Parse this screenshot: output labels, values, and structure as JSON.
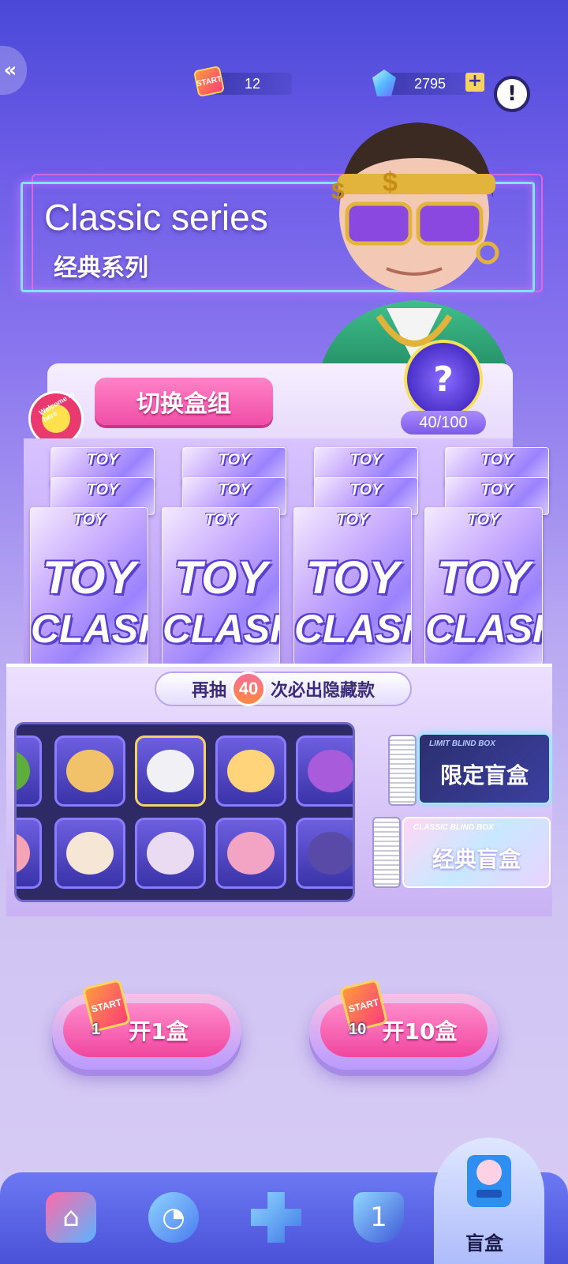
{
  "topbar": {
    "tickets": "12",
    "ticket_icon_label": "START",
    "gems": "2795",
    "plus": "+",
    "info": "!"
  },
  "series": {
    "title_en": "Classic series",
    "title_zh": "经典系列"
  },
  "shelf": {
    "switch_label": "切换盒组",
    "welcome_badge": "Welcome to here",
    "mystery_count": "40/100",
    "mystery_symbol": "?",
    "box_label_small": "TOY",
    "box_label_top": "TOY",
    "box_label_bottom": "CLASH"
  },
  "pity": {
    "prefix": "再抽",
    "count": "40",
    "suffix": "次必出隐藏款"
  },
  "prizes": {
    "items": [
      {
        "name": "green-toy",
        "color": "#5fae3d"
      },
      {
        "name": "bear-pilot",
        "color": "#f2c26b"
      },
      {
        "name": "bear-astronaut",
        "color": "#f1f1f5"
      },
      {
        "name": "tennis-girl",
        "color": "#ffd47a"
      },
      {
        "name": "purple-girl",
        "color": "#a85cdc"
      },
      {
        "name": "pink-toy",
        "color": "#f6a3b6"
      },
      {
        "name": "bear-goggles",
        "color": "#f6e6d6"
      },
      {
        "name": "bear-cap",
        "color": "#eadbf3"
      },
      {
        "name": "glasses-girl",
        "color": "#f3a3c4"
      },
      {
        "name": "sunglasses-girl",
        "color": "#5a4aa8"
      }
    ]
  },
  "ticket_buttons": {
    "limit_sub": "LIMIT BLIND BOX",
    "limit_label": "限定盲盒",
    "classic_sub": "CLASSIC BLIND BOX",
    "classic_label": "经典盲盒"
  },
  "open": {
    "one_label": "开1盒",
    "one_count": "1",
    "ten_label": "开10盒",
    "ten_count": "10",
    "ticket_text": "START"
  },
  "nav": {
    "active_label": "盲盒"
  },
  "colors": {
    "accent_pink": "#f04fa7",
    "accent_purple": "#7c5ae8",
    "nav_blue": "#4a52d8"
  }
}
